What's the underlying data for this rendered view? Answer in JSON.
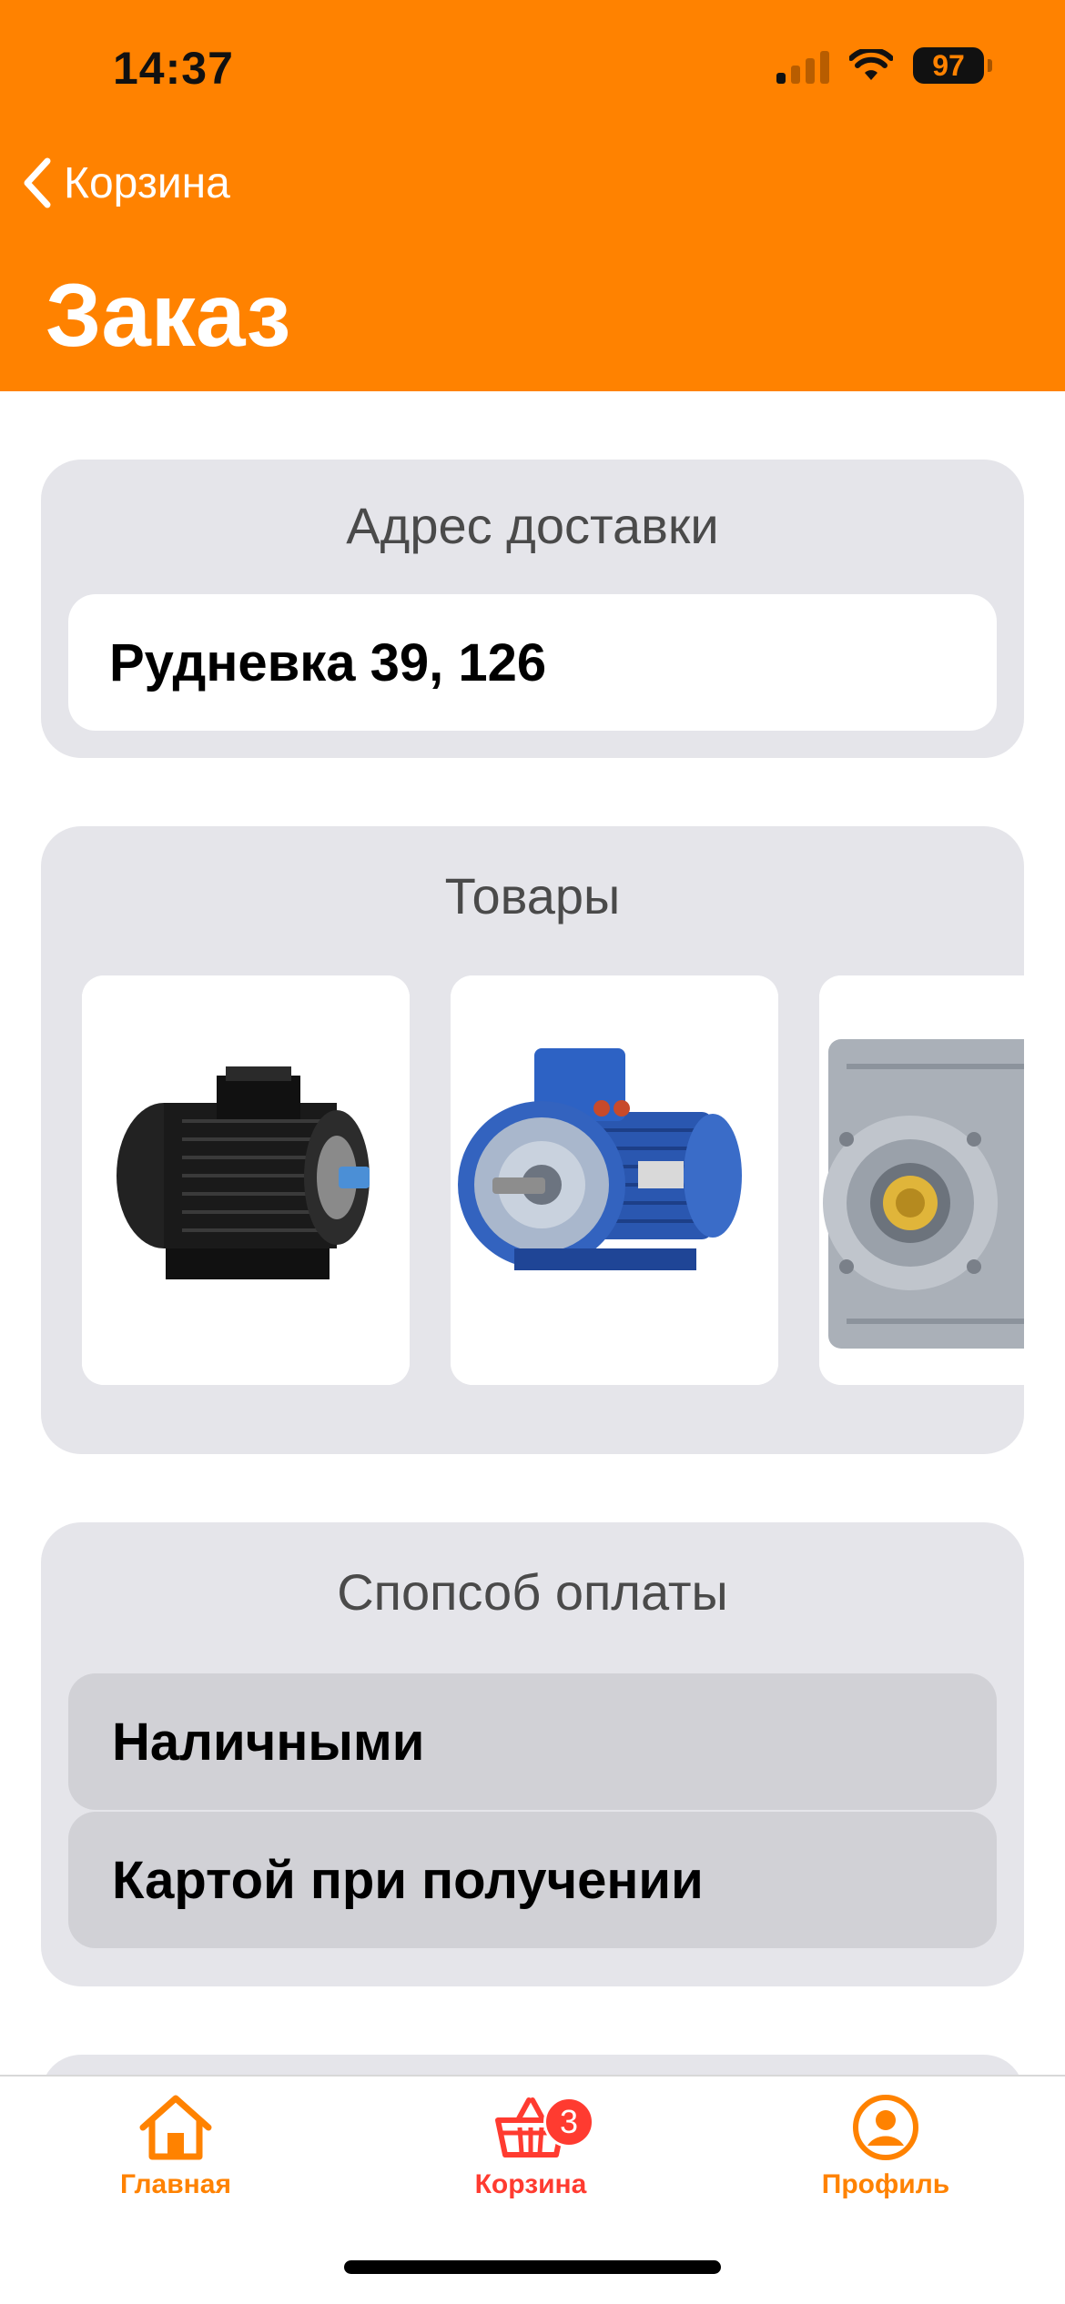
{
  "status_bar": {
    "time": "14:37",
    "battery": "97"
  },
  "nav": {
    "back_label": "Корзина",
    "title": "Заказ"
  },
  "address": {
    "section_title": "Адрес доставки",
    "value": "Рудневка 39, 126"
  },
  "goods": {
    "section_title": "Товары"
  },
  "payment": {
    "section_title": "Спопсоб оплаты",
    "options": [
      "Наличными",
      "Картой при получении"
    ]
  },
  "tabbar": {
    "items": [
      {
        "label": "Главная",
        "icon": "home-icon"
      },
      {
        "label": "Корзина",
        "icon": "basket-icon",
        "badge": "3"
      },
      {
        "label": "Профиль",
        "icon": "profile-icon"
      }
    ]
  },
  "colors": {
    "accent": "#FF8200",
    "cart_active": "#FF3B30",
    "card_bg": "#E5E5EA",
    "option_bg": "#D1D1D6"
  }
}
